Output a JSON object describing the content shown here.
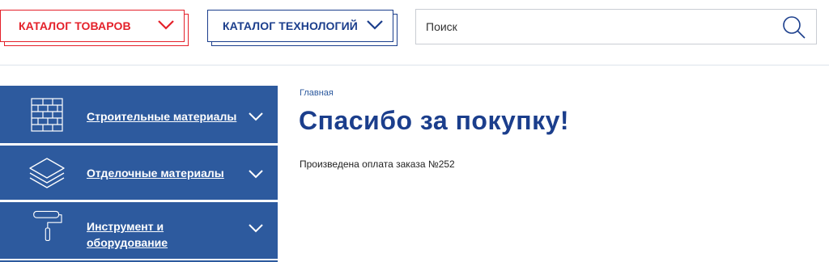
{
  "header": {
    "catalog_goods_label": "КАТАЛОГ ТОВАРОВ",
    "catalog_tech_label": "КАТАЛОГ ТЕХНОЛОГИЙ",
    "search": {
      "placeholder": "Поиск"
    }
  },
  "sidebar": {
    "items": [
      {
        "label": "Строительные материалы",
        "icon": "brick-wall-icon"
      },
      {
        "label": "Отделочные материалы",
        "icon": "layers-icon"
      },
      {
        "label_line1": "Инструмент и",
        "label_line2": "оборудование",
        "icon": "paint-roller-icon"
      }
    ]
  },
  "content": {
    "breadcrumb": "Главная",
    "title": "Спасибо за покупку!",
    "message": "Произведена оплата заказа №252"
  },
  "colors": {
    "brand_red": "#e4212a",
    "brand_blue": "#1b3e8c",
    "sidebar_blue": "#2d5a9e"
  }
}
